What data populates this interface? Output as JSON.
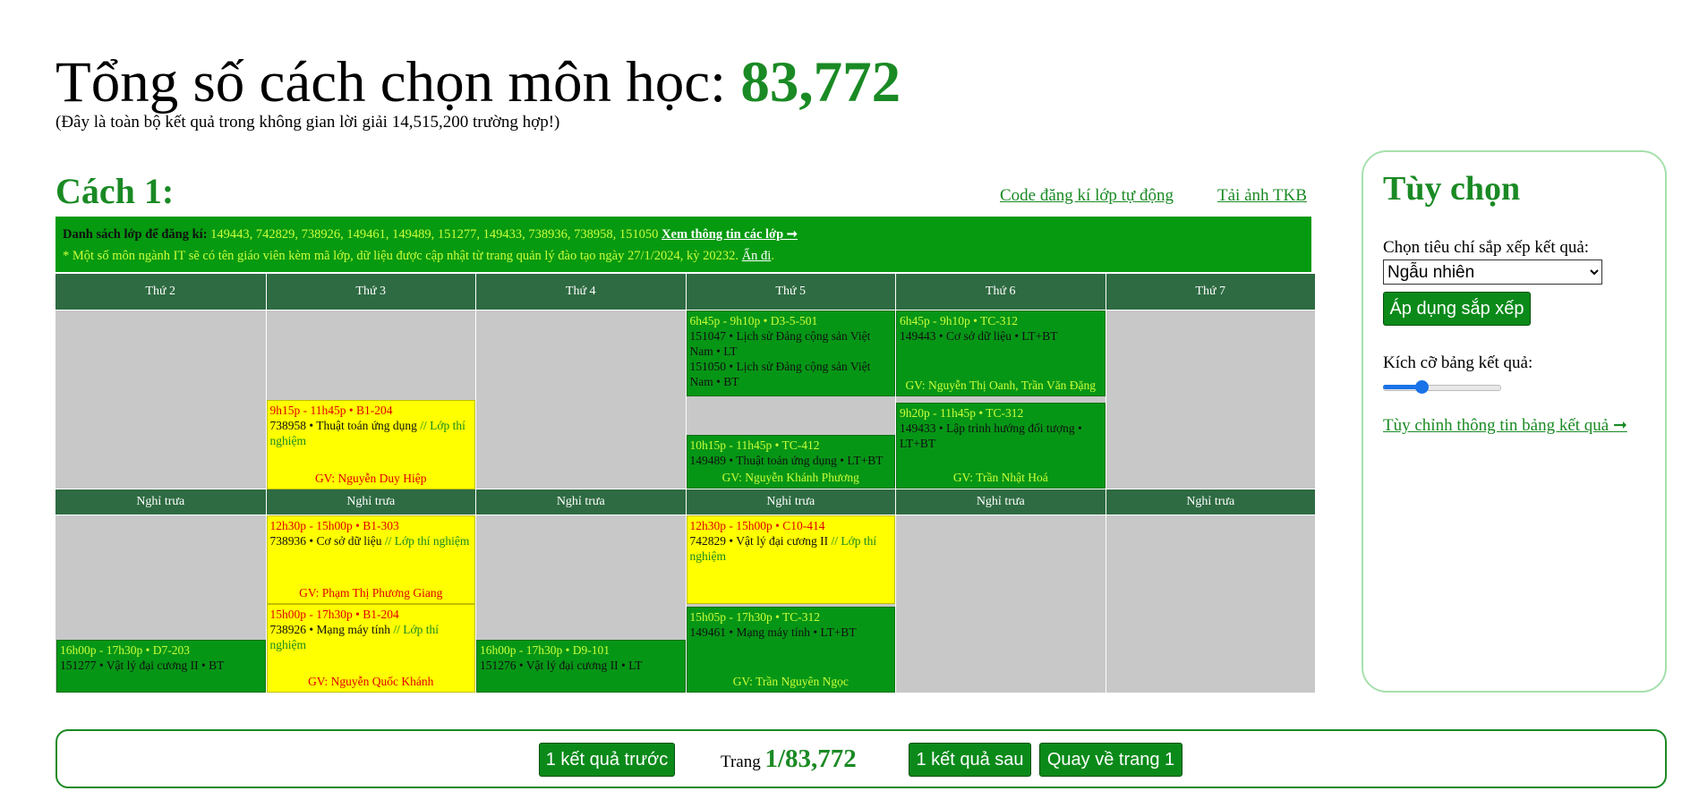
{
  "header": {
    "title_prefix": "Tổng số cách chọn môn học: ",
    "total": "83,772",
    "subtitle": "(Đây là toàn bộ kết quả trong không gian lời giải 14,515,200 trường hợp!)"
  },
  "result": {
    "heading": "Cách 1:",
    "links": {
      "auto_code": "Code đăng kí lớp tự động",
      "download": "Tải ảnh TKB"
    },
    "banner": {
      "label": "Danh sách lớp để đăng kí:",
      "ids": " 149443, 742829, 738926, 149461, 149489, 151277, 149433, 738936, 738958, 151050 ",
      "info_link": "Xem thông tin các lớp ➞",
      "note": "* Một số môn ngành IT sẽ có tên giáo viên kèm mã lớp, dữ liệu được cập nhật từ trang quản lý đào tạo ngày 27/1/2024, kỳ 20232. ",
      "hide_link": "Ẩn đi",
      "note_end": "."
    }
  },
  "timetable": {
    "days": [
      "Thứ 2",
      "Thứ 3",
      "Thứ 4",
      "Thứ 5",
      "Thứ 6",
      "Thứ 7"
    ],
    "lunch": "Nghỉ trưa",
    "classes": [
      {
        "day": 3,
        "session": "morning",
        "start_min": 405,
        "end_min": 550,
        "color": "green",
        "time": "6h45p - 9h10p • D3-5-501",
        "lines": [
          "151047 • Lịch sử Đảng cộng sản Việt Nam • LT",
          "151050 • Lịch sử Đảng cộng sản Việt Nam • BT"
        ],
        "tag": "",
        "gv": ""
      },
      {
        "day": 4,
        "session": "morning",
        "start_min": 405,
        "end_min": 550,
        "color": "green",
        "time": "6h45p - 9h10p • TC-312",
        "lines": [
          "149443 • Cơ sở dữ liệu • LT+BT"
        ],
        "tag": "",
        "gv": "GV: Nguyễn Thị Oanh, Trần Văn Đặng"
      },
      {
        "day": 1,
        "session": "morning",
        "start_min": 555,
        "end_min": 705,
        "color": "yellow",
        "time": "9h15p - 11h45p • B1-204",
        "lines": [
          "738958 • Thuật toán ứng dụng "
        ],
        "tag": "// Lớp thí nghiệm",
        "gv": "GV: Nguyễn Duy Hiệp"
      },
      {
        "day": 4,
        "session": "morning",
        "start_min": 560,
        "end_min": 705,
        "color": "green",
        "time": "9h20p - 11h45p • TC-312",
        "lines": [
          "149433 • Lập trình hướng đối tượng • LT+BT"
        ],
        "tag": "",
        "gv": "GV: Trần Nhật Hoá"
      },
      {
        "day": 3,
        "session": "morning",
        "start_min": 615,
        "end_min": 705,
        "color": "green",
        "time": "10h15p - 11h45p • TC-412",
        "lines": [
          "149489 • Thuật toán ứng dụng • LT+BT"
        ],
        "tag": "",
        "gv": "GV: Nguyễn Khánh Phương"
      },
      {
        "day": 1,
        "session": "afternoon",
        "start_min": 750,
        "end_min": 900,
        "color": "yellow",
        "time": "12h30p - 15h00p • B1-303",
        "lines": [
          "738936 • Cơ sở dữ liệu "
        ],
        "tag": "// Lớp thí nghiệm",
        "gv": "GV: Phạm Thị Phương Giang"
      },
      {
        "day": 3,
        "session": "afternoon",
        "start_min": 750,
        "end_min": 900,
        "color": "yellow",
        "time": "12h30p - 15h00p • C10-414",
        "lines": [
          "742829 • Vật lý đại cương II "
        ],
        "tag": "// Lớp thí nghiệm",
        "gv": ""
      },
      {
        "day": 1,
        "session": "afternoon",
        "start_min": 900,
        "end_min": 1050,
        "color": "yellow",
        "time": "15h00p - 17h30p • B1-204",
        "lines": [
          "738926 • Mạng máy tính "
        ],
        "tag": "// Lớp thí nghiệm",
        "gv": "GV: Nguyễn Quốc Khánh"
      },
      {
        "day": 3,
        "session": "afternoon",
        "start_min": 905,
        "end_min": 1050,
        "color": "green",
        "time": "15h05p - 17h30p • TC-312",
        "lines": [
          "149461 • Mạng máy tính • LT+BT"
        ],
        "tag": "",
        "gv": "GV: Trần Nguyên Ngọc"
      },
      {
        "day": 0,
        "session": "afternoon",
        "start_min": 960,
        "end_min": 1050,
        "color": "green",
        "time": "16h00p - 17h30p • D7-203",
        "lines": [
          "151277 • Vật lý đại cương II • BT"
        ],
        "tag": "",
        "gv": ""
      },
      {
        "day": 2,
        "session": "afternoon",
        "start_min": 960,
        "end_min": 1050,
        "color": "green",
        "time": "16h00p - 17h30p • D9-101",
        "lines": [
          "151276 • Vật lý đại cương II • LT"
        ],
        "tag": "",
        "gv": ""
      }
    ]
  },
  "options": {
    "title": "Tùy chọn",
    "sort_label": "Chọn tiêu chí sắp xếp kết quả:",
    "sort_selected": "Ngẫu nhiên",
    "apply_button": "Áp dụng sắp xếp",
    "size_label": "Kích cỡ bảng kết quả:",
    "size_value_percent": 33,
    "customize_link": "Tùy chỉnh thông tin bảng kết quả ➞"
  },
  "pager": {
    "prev_button": "1 kết quả trước",
    "page_label": "Trang ",
    "page_value": "1/83,772",
    "next_button": "1 kết quả sau",
    "first_button": "Quay về trang 1"
  },
  "colors": {
    "green": "#069616",
    "yellow": "#ffff00",
    "header": "#2e6b42",
    "empty": "#c8c8c8",
    "accent": "#1a8a24"
  }
}
